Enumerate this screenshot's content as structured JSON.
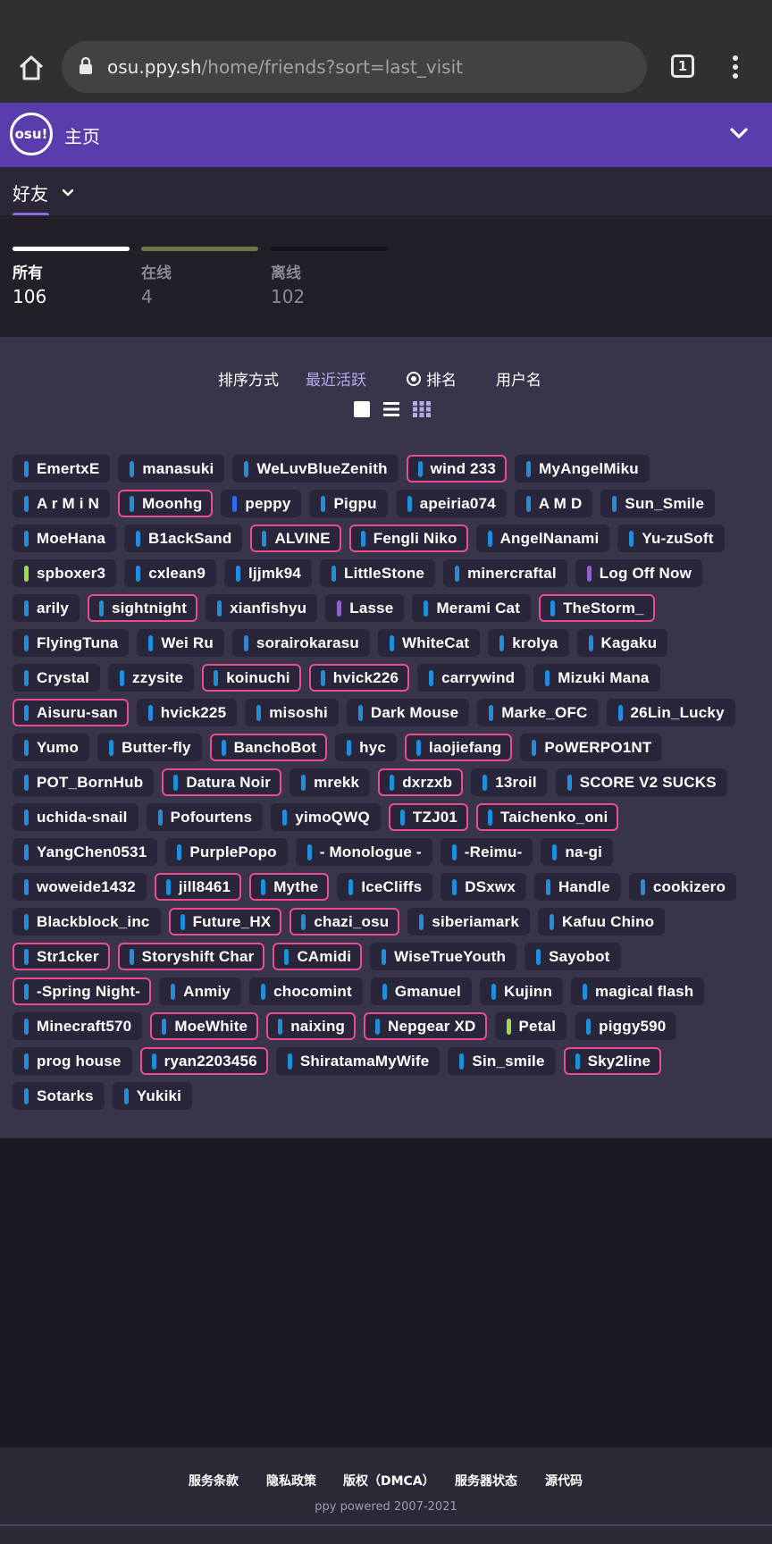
{
  "browser": {
    "url_host": "osu.ppy.sh",
    "url_path": "/home/friends?sort=last_visit",
    "tab_count": "1"
  },
  "header": {
    "title": "主页",
    "logo_text": "osu!"
  },
  "subnav": {
    "label": "好友"
  },
  "stats": [
    {
      "label": "所有",
      "value": "106",
      "color": "#ffffff",
      "value_color": "#ffffff"
    },
    {
      "label": "在线",
      "value": "4",
      "color": "#6f7740",
      "value_color": "#8c8996"
    },
    {
      "label": "离线",
      "value": "102",
      "color": "#15141a",
      "value_color": "#8c8996"
    }
  ],
  "sort": {
    "label": "排序方式",
    "options": [
      "最近活跃",
      "排名",
      "用户名"
    ],
    "selected": "排名"
  },
  "friends": [
    [
      [
        "EmertxE",
        "#1e8fd8",
        false
      ],
      [
        "manasuki",
        "#1e8fd8",
        false
      ],
      [
        "WeLuvBlueZenith",
        "#1e8fd8",
        false
      ],
      [
        "wind 233",
        "#1e8fd8",
        true
      ],
      [
        "MyAngelMiku",
        "#1e8fd8",
        false
      ]
    ],
    [
      [
        "A r M i N",
        "#1e8fd8",
        false
      ],
      [
        "Moonhg",
        "#1e8fd8",
        true
      ],
      [
        "peppy",
        "#2a6df0",
        false
      ],
      [
        "Pigpu",
        "#1e8fd8",
        false
      ],
      [
        "apeiria074",
        "#1e8fd8",
        false
      ],
      [
        "A M D",
        "#1e8fd8",
        false
      ],
      [
        "Sun_Smile",
        "#1e8fd8",
        false
      ]
    ],
    [
      [
        "MoeHana",
        "#1e8fd8",
        false
      ],
      [
        "B1ackSand",
        "#1e8fd8",
        false
      ],
      [
        "ALVINE",
        "#1e8fd8",
        true
      ],
      [
        "Fengli Niko",
        "#1e8fd8",
        true
      ],
      [
        "AngelNanami",
        "#1e8fd8",
        false
      ],
      [
        "Yu-zuSoft",
        "#1e8fd8",
        false
      ]
    ],
    [
      [
        "spboxer3",
        "#a0d94a",
        false
      ],
      [
        "cxlean9",
        "#1e8fd8",
        false
      ],
      [
        "ljjmk94",
        "#1e8fd8",
        false
      ],
      [
        "LittleStone",
        "#1e8fd8",
        false
      ],
      [
        "minercraftal",
        "#1e8fd8",
        false
      ],
      [
        "Log Off Now",
        "#9b59e0",
        false
      ]
    ],
    [
      [
        "arily",
        "#1e8fd8",
        false
      ],
      [
        "sightnight",
        "#1e8fd8",
        true
      ],
      [
        "xianfishyu",
        "#1e8fd8",
        false
      ],
      [
        "Lasse",
        "#9b59e0",
        false
      ],
      [
        "Merami Cat",
        "#1e8fd8",
        false
      ],
      [
        "TheStorm_",
        "#1e8fd8",
        true
      ]
    ],
    [
      [
        "FlyingTuna",
        "#1e8fd8",
        false
      ],
      [
        "Wei Ru",
        "#1e8fd8",
        false
      ],
      [
        "sorairokarasu",
        "#1e8fd8",
        false
      ],
      [
        "WhiteCat",
        "#1e8fd8",
        false
      ],
      [
        "kroIya",
        "#1e8fd8",
        false
      ],
      [
        "Kagaku",
        "#1e8fd8",
        false
      ]
    ],
    [
      [
        "Crystal",
        "#1e8fd8",
        false
      ],
      [
        "zzysite",
        "#1e8fd8",
        false
      ],
      [
        "koinuchi",
        "#1e8fd8",
        true
      ],
      [
        "hvick226",
        "#1e8fd8",
        true
      ],
      [
        "carrywind",
        "#1e8fd8",
        false
      ],
      [
        "Mizuki Mana",
        "#1e8fd8",
        false
      ]
    ],
    [
      [
        "Aisuru-san",
        "#1e8fd8",
        true
      ],
      [
        "hvick225",
        "#1e8fd8",
        false
      ],
      [
        "misoshi",
        "#1e8fd8",
        false
      ],
      [
        "Dark Mouse",
        "#1e8fd8",
        false
      ],
      [
        "Marke_OFC",
        "#1e8fd8",
        false
      ],
      [
        "26Lin_Lucky",
        "#1e8fd8",
        false
      ]
    ],
    [
      [
        "Yumo",
        "#1e8fd8",
        false
      ],
      [
        "Butter-fly",
        "#1e8fd8",
        false
      ],
      [
        "BanchoBot",
        "#1e8fd8",
        true
      ],
      [
        "hyc",
        "#1e8fd8",
        false
      ],
      [
        "laojiefang",
        "#1e8fd8",
        true
      ],
      [
        "PoWERPO1NT",
        "#1e8fd8",
        false
      ]
    ],
    [
      [
        "POT_BornHub",
        "#1e8fd8",
        false
      ],
      [
        "Datura Noir",
        "#1e8fd8",
        true
      ],
      [
        "mrekk",
        "#1e8fd8",
        false
      ],
      [
        "dxrzxb",
        "#1e8fd8",
        true
      ],
      [
        "13roil",
        "#1e8fd8",
        false
      ],
      [
        "SCORE V2 SUCKS",
        "#1e8fd8",
        false
      ]
    ],
    [
      [
        "uchida-snail",
        "#1e8fd8",
        false
      ],
      [
        "Pofourtens",
        "#1e8fd8",
        false
      ],
      [
        "yimoQWQ",
        "#1e8fd8",
        false
      ],
      [
        "TZJ01",
        "#1e8fd8",
        true
      ],
      [
        "Taichenko_oni",
        "#1e8fd8",
        true
      ]
    ],
    [
      [
        "YangChen0531",
        "#1e8fd8",
        false
      ],
      [
        "PurplePopo",
        "#1e8fd8",
        false
      ],
      [
        "- Monologue -",
        "#1e8fd8",
        false
      ],
      [
        "-Reimu-",
        "#1e8fd8",
        false
      ],
      [
        "na-gi",
        "#1e8fd8",
        false
      ]
    ],
    [
      [
        "woweide1432",
        "#1e8fd8",
        false
      ],
      [
        "jill8461",
        "#1e8fd8",
        true
      ],
      [
        "Mythe",
        "#1e8fd8",
        true
      ],
      [
        "IceCliffs",
        "#1e8fd8",
        false
      ],
      [
        "DSxwx",
        "#1e8fd8",
        false
      ],
      [
        "Handle",
        "#1e8fd8",
        false
      ],
      [
        "cookizero",
        "#1e8fd8",
        false
      ]
    ],
    [
      [
        "Blackblock_inc",
        "#1e8fd8",
        false
      ],
      [
        "Future_HX",
        "#1e8fd8",
        true
      ],
      [
        "chazi_osu",
        "#1e8fd8",
        true
      ],
      [
        "siberiamark",
        "#1e8fd8",
        false
      ],
      [
        "Kafuu Chino",
        "#1e8fd8",
        false
      ]
    ],
    [
      [
        "Str1cker",
        "#1e8fd8",
        true
      ],
      [
        "Storyshift Char",
        "#1e8fd8",
        true
      ],
      [
        "CAmidi",
        "#1e8fd8",
        true
      ],
      [
        "WiseTrueYouth",
        "#1e8fd8",
        false
      ],
      [
        "Sayobot",
        "#1e8fd8",
        false
      ]
    ],
    [
      [
        "-Spring Night-",
        "#1e8fd8",
        true
      ],
      [
        "Anmiy",
        "#1e8fd8",
        false
      ],
      [
        "chocomint",
        "#1e8fd8",
        false
      ],
      [
        "Gmanuel",
        "#1e8fd8",
        false
      ],
      [
        "Kujinn",
        "#1e8fd8",
        false
      ],
      [
        "magical flash",
        "#1e8fd8",
        false
      ]
    ],
    [
      [
        "Minecraft570",
        "#1e8fd8",
        false
      ],
      [
        "MoeWhite",
        "#1e8fd8",
        true
      ],
      [
        "naixing",
        "#1e8fd8",
        true
      ],
      [
        "Nepgear XD",
        "#1e8fd8",
        true
      ],
      [
        "Petal",
        "#a0d94a",
        false
      ],
      [
        "piggy590",
        "#1e8fd8",
        false
      ]
    ],
    [
      [
        "prog house",
        "#1e8fd8",
        false
      ],
      [
        "ryan2203456",
        "#1e8fd8",
        true
      ],
      [
        "ShiratamaMyWife",
        "#1e8fd8",
        false
      ],
      [
        "Sin_smile",
        "#1e8fd8",
        false
      ],
      [
        "Sky2line",
        "#1e8fd8",
        true
      ]
    ],
    [
      [
        "Sotarks",
        "#1e8fd8",
        false
      ],
      [
        "Yukiki",
        "#1e8fd8",
        false
      ]
    ]
  ],
  "footer": {
    "links": [
      "服务条款",
      "隐私政策",
      "版权（DMCA）",
      "服务器状态",
      "源代码"
    ],
    "copyright": "ppy powered 2007-2021"
  }
}
